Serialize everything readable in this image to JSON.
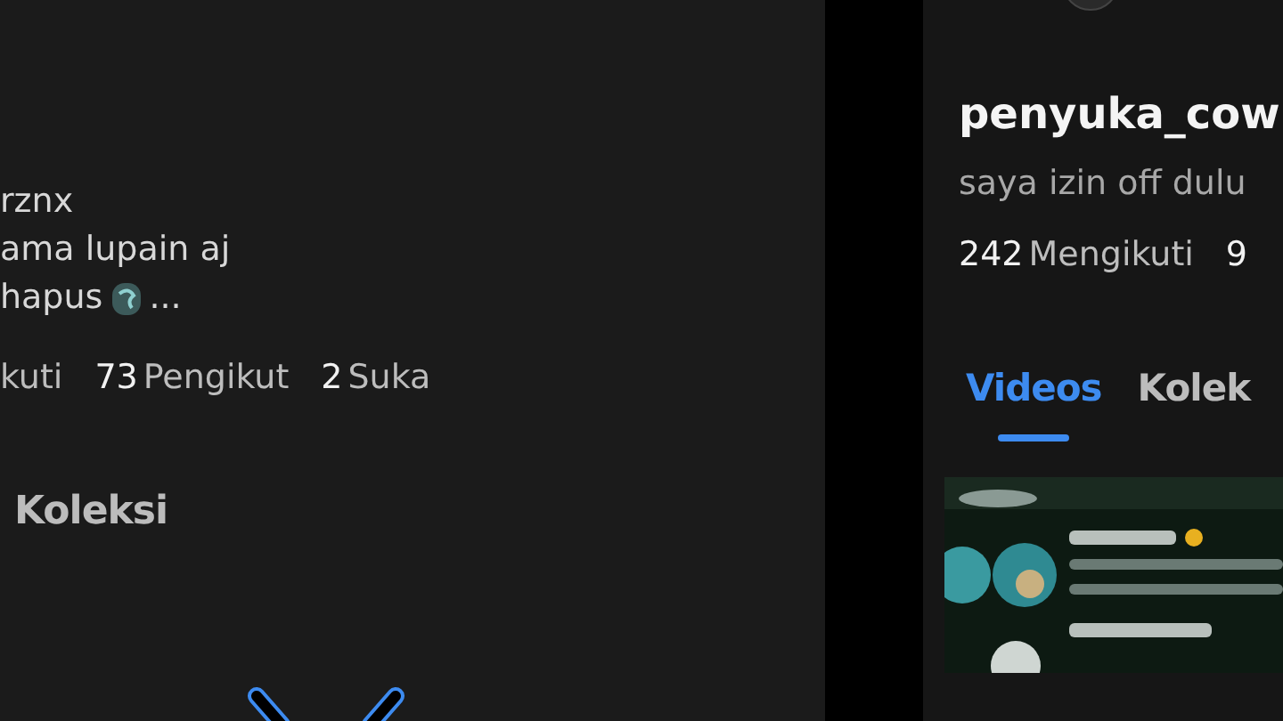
{
  "left_profile": {
    "username": "rznx",
    "bio_lines": [
      "ama lupain aj",
      "hapus"
    ],
    "bio_ellipsis": "...",
    "stats": [
      {
        "label": "kuti"
      },
      {
        "number": "73",
        "label": "Pengikut"
      },
      {
        "number": "2",
        "label": "Suka"
      }
    ],
    "tabs": [
      {
        "label": "Koleksi",
        "selected": false
      }
    ]
  },
  "right_profile": {
    "username": "penyuka_cow",
    "bio": "saya izin off dulu",
    "stats": [
      {
        "number": "242",
        "label": "Mengikuti"
      },
      {
        "number": "9"
      }
    ],
    "tabs": [
      {
        "label": "Videos",
        "selected": true
      },
      {
        "label": "Kolek",
        "selected": false
      }
    ]
  }
}
